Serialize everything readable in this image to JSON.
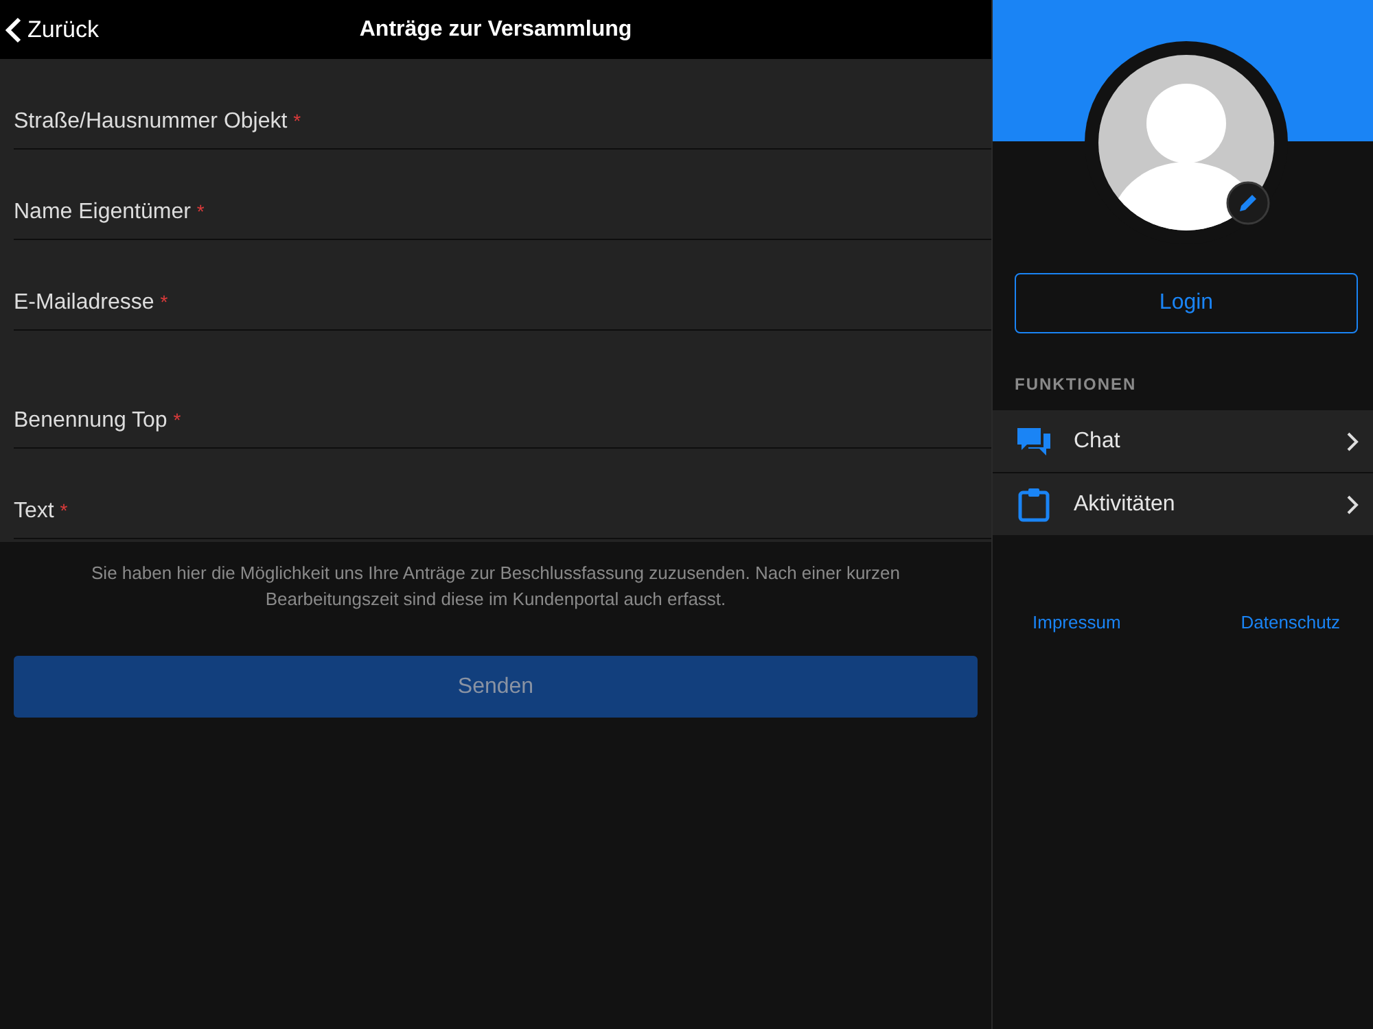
{
  "nav_bar": {
    "back": "Zurück",
    "title": "Anträge zur Versammlung"
  },
  "form": {
    "fields": [
      {
        "label": "Straße/Hausnummer Objekt",
        "required_mark": "*"
      },
      {
        "label": "Name Eigentümer",
        "required_mark": "*"
      },
      {
        "label": "E-Mailadresse",
        "required_mark": "*"
      },
      {
        "label": "Benennung Top",
        "required_mark": "*"
      },
      {
        "label": "Text",
        "required_mark": "*"
      }
    ],
    "hint": "Sie haben hier die Möglichkeit uns Ihre Anträge zur Beschlussfassung zuzusenden. Nach einer kurzen Bearbeitungszeit sind diese im Kundenportal auch erfasst.",
    "submit": {
      "label": "Senden",
      "disabled": true
    }
  },
  "sidebar": {
    "login_button": "Login",
    "section_title": "FUNKTIONEN",
    "items": [
      {
        "kind": "chat",
        "label": "Chat"
      },
      {
        "kind": "clipboard",
        "label": "Aktivitäten"
      }
    ],
    "footer_links": [
      "Impressum",
      "Datenschutz"
    ]
  }
}
